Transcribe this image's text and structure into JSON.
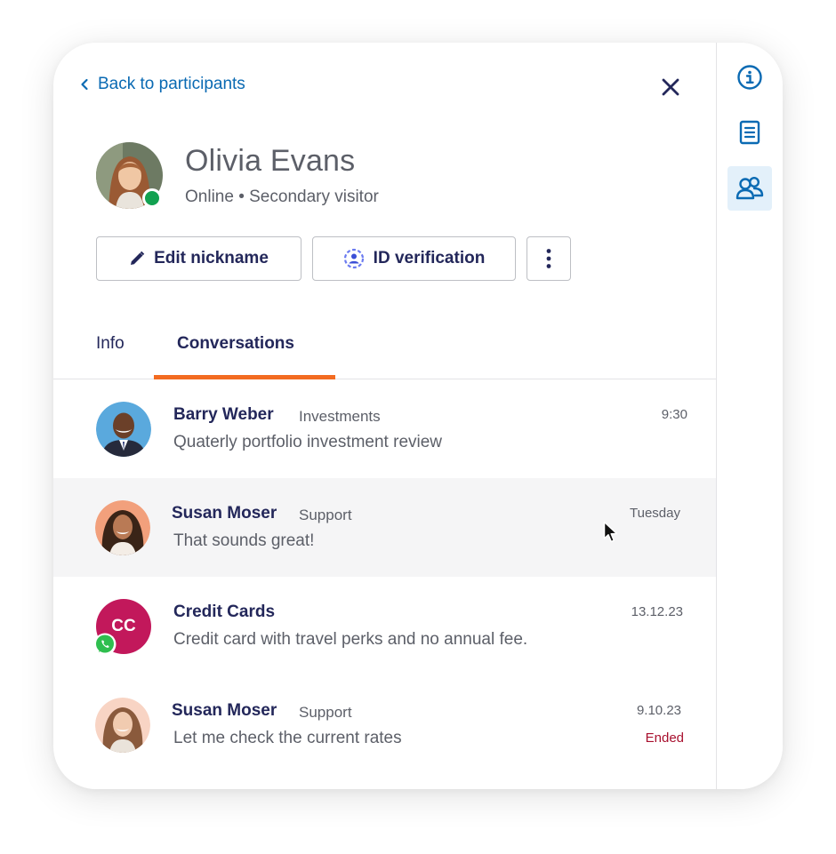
{
  "colors": {
    "link": "#0a6ab3",
    "navy": "#23275a",
    "muted": "#5c5f68",
    "online": "#12a150",
    "accent_tab": "#f36b21",
    "ended": "#a8102e",
    "cc_avatar": "#c2185b",
    "rail_active": "#e3f0fa"
  },
  "rail": {
    "items": [
      {
        "icon": "info-icon",
        "active": false
      },
      {
        "icon": "notes-icon",
        "active": false
      },
      {
        "icon": "participants-icon",
        "active": true
      }
    ]
  },
  "header": {
    "back_label": "Back to participants",
    "close_icon": "close-icon"
  },
  "profile": {
    "name": "Olivia Evans",
    "subtitle": "Online • Secondary visitor",
    "status": "online"
  },
  "actions": {
    "edit_nickname": "Edit nickname",
    "id_verification": "ID verification",
    "more_icon": "more-vertical-icon"
  },
  "tabs": {
    "info": "Info",
    "conversations": "Conversations",
    "active": "conversations"
  },
  "conversations": [
    {
      "name": "Barry Weber",
      "team": "Investments",
      "message": "Quaterly portfolio investment review",
      "time": "9:30",
      "status": ""
    },
    {
      "name": "Susan Moser",
      "team": "Support",
      "message": "That sounds great!",
      "time": "Tuesday",
      "status": ""
    },
    {
      "name": "Credit Cards",
      "initials": "CC",
      "team": "",
      "message": "Credit card with travel perks and no annual fee.",
      "time": "13.12.23",
      "status": "",
      "channel_icon": "whatsapp-icon"
    },
    {
      "name": "Susan Moser",
      "team": "Support",
      "message": "Let me check the current rates",
      "time": "9.10.23",
      "status": "Ended"
    }
  ]
}
